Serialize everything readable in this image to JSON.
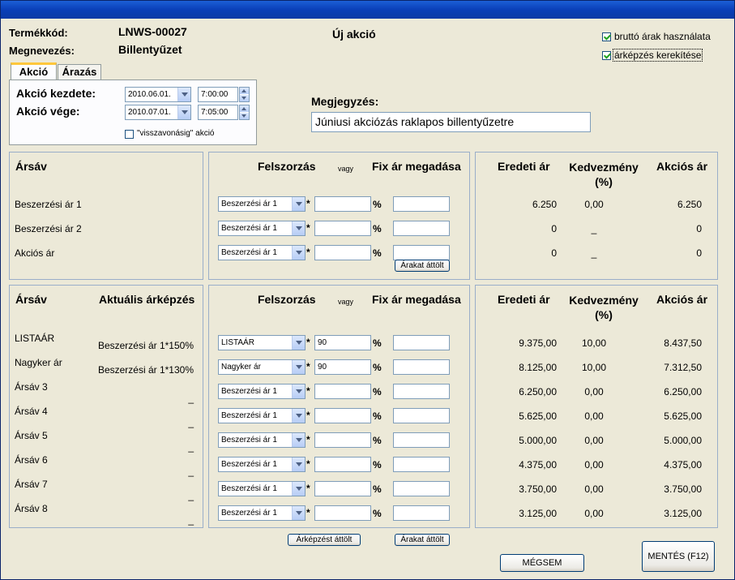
{
  "header": {
    "product_code_label": "Termékkód:",
    "product_code": "LNWS-00027",
    "name_label": "Megnevezés:",
    "name": "Billentyűzet",
    "title": "Új akció"
  },
  "options": {
    "gross_label": "bruttó árak használata",
    "gross_checked": true,
    "round_label": "árképzés kerekítése",
    "round_checked": true
  },
  "tabs": [
    "Akció",
    "Árazás"
  ],
  "action": {
    "start_label": "Akció kezdete:",
    "start_date": "2010.06.01.",
    "start_time": "7:00:00",
    "end_label": "Akció vége:",
    "end_date": "2010.07.01.",
    "end_time": "7:05:00",
    "until_revoked_label": "\"visszavonásig\" akció",
    "until_revoked_checked": false
  },
  "note": {
    "label": "Megjegyzés:",
    "value": "Júniusi akciózás raklapos billentyűzetre"
  },
  "top": {
    "col_arsav": "Ársáv",
    "col_markup": "Felszorzás",
    "col_or": "vagy",
    "col_fix": "Fix ár megadása",
    "col_orig": "Eredeti ár",
    "col_disc": "Kedvezmény (%)",
    "col_sale": "Akciós ár",
    "copy_prices": "Árakat áttölt",
    "rows": [
      {
        "name": "Beszerzési ár 1",
        "base": "Beszerzési ár 1",
        "markup": "",
        "fix": "",
        "orig": "6.250",
        "disc": "0,00",
        "sale": "6.250"
      },
      {
        "name": "Beszerzési ár 2",
        "base": "Beszerzési ár 1",
        "markup": "",
        "fix": "",
        "orig": "0",
        "disc": "_",
        "sale": "0"
      },
      {
        "name": "Akciós ár",
        "base": "Beszerzési ár 1",
        "markup": "",
        "fix": "",
        "orig": "0",
        "disc": "_",
        "sale": "0"
      }
    ]
  },
  "bottom": {
    "col_arsav": "Ársáv",
    "col_current": "Aktuális árképzés",
    "col_markup": "Felszorzás",
    "col_or": "vagy",
    "col_fix": "Fix ár megadása",
    "col_orig": "Eredeti ár",
    "col_disc": "Kedvezmény (%)",
    "col_sale": "Akciós ár",
    "rows": [
      {
        "name": "LISTAÁR",
        "current": "Beszerzési ár 1*150%",
        "base": "LISTAÁR",
        "markup": "90",
        "fix": "",
        "orig": "9.375,00",
        "disc": "10,00",
        "sale": "8.437,50"
      },
      {
        "name": "Nagyker ár",
        "current": "Beszerzési ár 1*130%",
        "base": "Nagyker ár",
        "markup": "90",
        "fix": "",
        "orig": "8.125,00",
        "disc": "10,00",
        "sale": "7.312,50"
      },
      {
        "name": "Ársáv 3",
        "current": "_",
        "base": "Beszerzési ár 1",
        "markup": "",
        "fix": "",
        "orig": "6.250,00",
        "disc": "0,00",
        "sale": "6.250,00"
      },
      {
        "name": "Ársáv 4",
        "current": "_",
        "base": "Beszerzési ár 1",
        "markup": "",
        "fix": "",
        "orig": "5.625,00",
        "disc": "0,00",
        "sale": "5.625,00"
      },
      {
        "name": "Ársáv 5",
        "current": "_",
        "base": "Beszerzési ár 1",
        "markup": "",
        "fix": "",
        "orig": "5.000,00",
        "disc": "0,00",
        "sale": "5.000,00"
      },
      {
        "name": "Ársáv 6",
        "current": "_",
        "base": "Beszerzési ár 1",
        "markup": "",
        "fix": "",
        "orig": "4.375,00",
        "disc": "0,00",
        "sale": "4.375,00"
      },
      {
        "name": "Ársáv 7",
        "current": "_",
        "base": "Beszerzési ár 1",
        "markup": "",
        "fix": "",
        "orig": "3.750,00",
        "disc": "0,00",
        "sale": "3.750,00"
      },
      {
        "name": "Ársáv 8",
        "current": "_",
        "base": "Beszerzési ár 1",
        "markup": "",
        "fix": "",
        "orig": "3.125,00",
        "disc": "0,00",
        "sale": "3.125,00"
      }
    ],
    "copy_pricing": "Árképzést áttölt",
    "copy_prices": "Árakat áttölt"
  },
  "buttons": {
    "cancel": "MÉGSEM",
    "save": "MENTÉS (F12)"
  }
}
